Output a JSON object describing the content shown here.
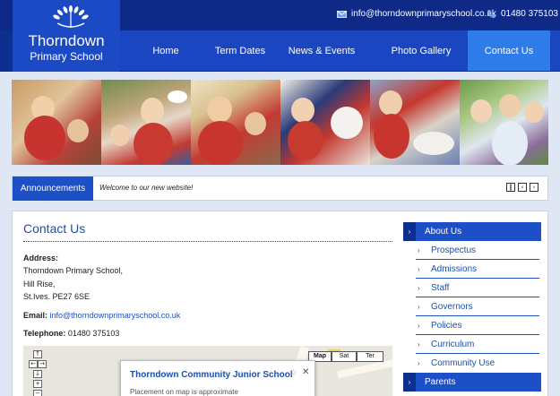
{
  "header": {
    "school_name_line1": "Thorndown",
    "school_name_line2": "Primary School",
    "logo_icon": "wheat-sheaf-logo",
    "email": "info@thorndownprimaryschool.co.uk",
    "phone": "01480 375103",
    "colors": {
      "header_bg": "#0d2f8e",
      "nav_bg": "#1a46c2",
      "nav_active": "#2f7be9"
    }
  },
  "nav": {
    "items": [
      {
        "label": "Home"
      },
      {
        "label": "Term Dates"
      },
      {
        "label": "News & Events"
      },
      {
        "label": "Photo Gallery"
      },
      {
        "label": "Contact Us",
        "active": true
      }
    ]
  },
  "announcements": {
    "label": "Announcements",
    "text": "Welcome to our new website!",
    "controls": [
      "pause-icon",
      "prev-icon",
      "next-icon"
    ]
  },
  "main": {
    "title": "Contact Us",
    "address_label": "Address:",
    "address_lines": [
      "Thorndown Primary School,",
      "Hill Rise,",
      "St.Ives. PE27 6SE"
    ],
    "email_label": "Email:",
    "email_value": "info@thorndownprimaryschool.co.uk",
    "telephone_label": "Telephone:",
    "telephone_value": "01480 375103"
  },
  "map": {
    "types": [
      "Map",
      "Sat",
      "Ter"
    ],
    "info_title": "Thorndown Community Junior School",
    "info_sub": "Placement on map is approximate",
    "nav_controls": [
      "up-icon",
      "left-icon",
      "right-icon",
      "zoom-in-icon",
      "zoom-out-icon"
    ]
  },
  "sidebar": {
    "header": "About Us",
    "items": [
      {
        "label": "Prospectus"
      },
      {
        "label": "Admissions"
      },
      {
        "label": "Staff"
      },
      {
        "label": "Governors"
      },
      {
        "label": "Policies"
      },
      {
        "label": "Curriculum"
      },
      {
        "label": "Community Use"
      }
    ],
    "footer_header": "Parents"
  }
}
